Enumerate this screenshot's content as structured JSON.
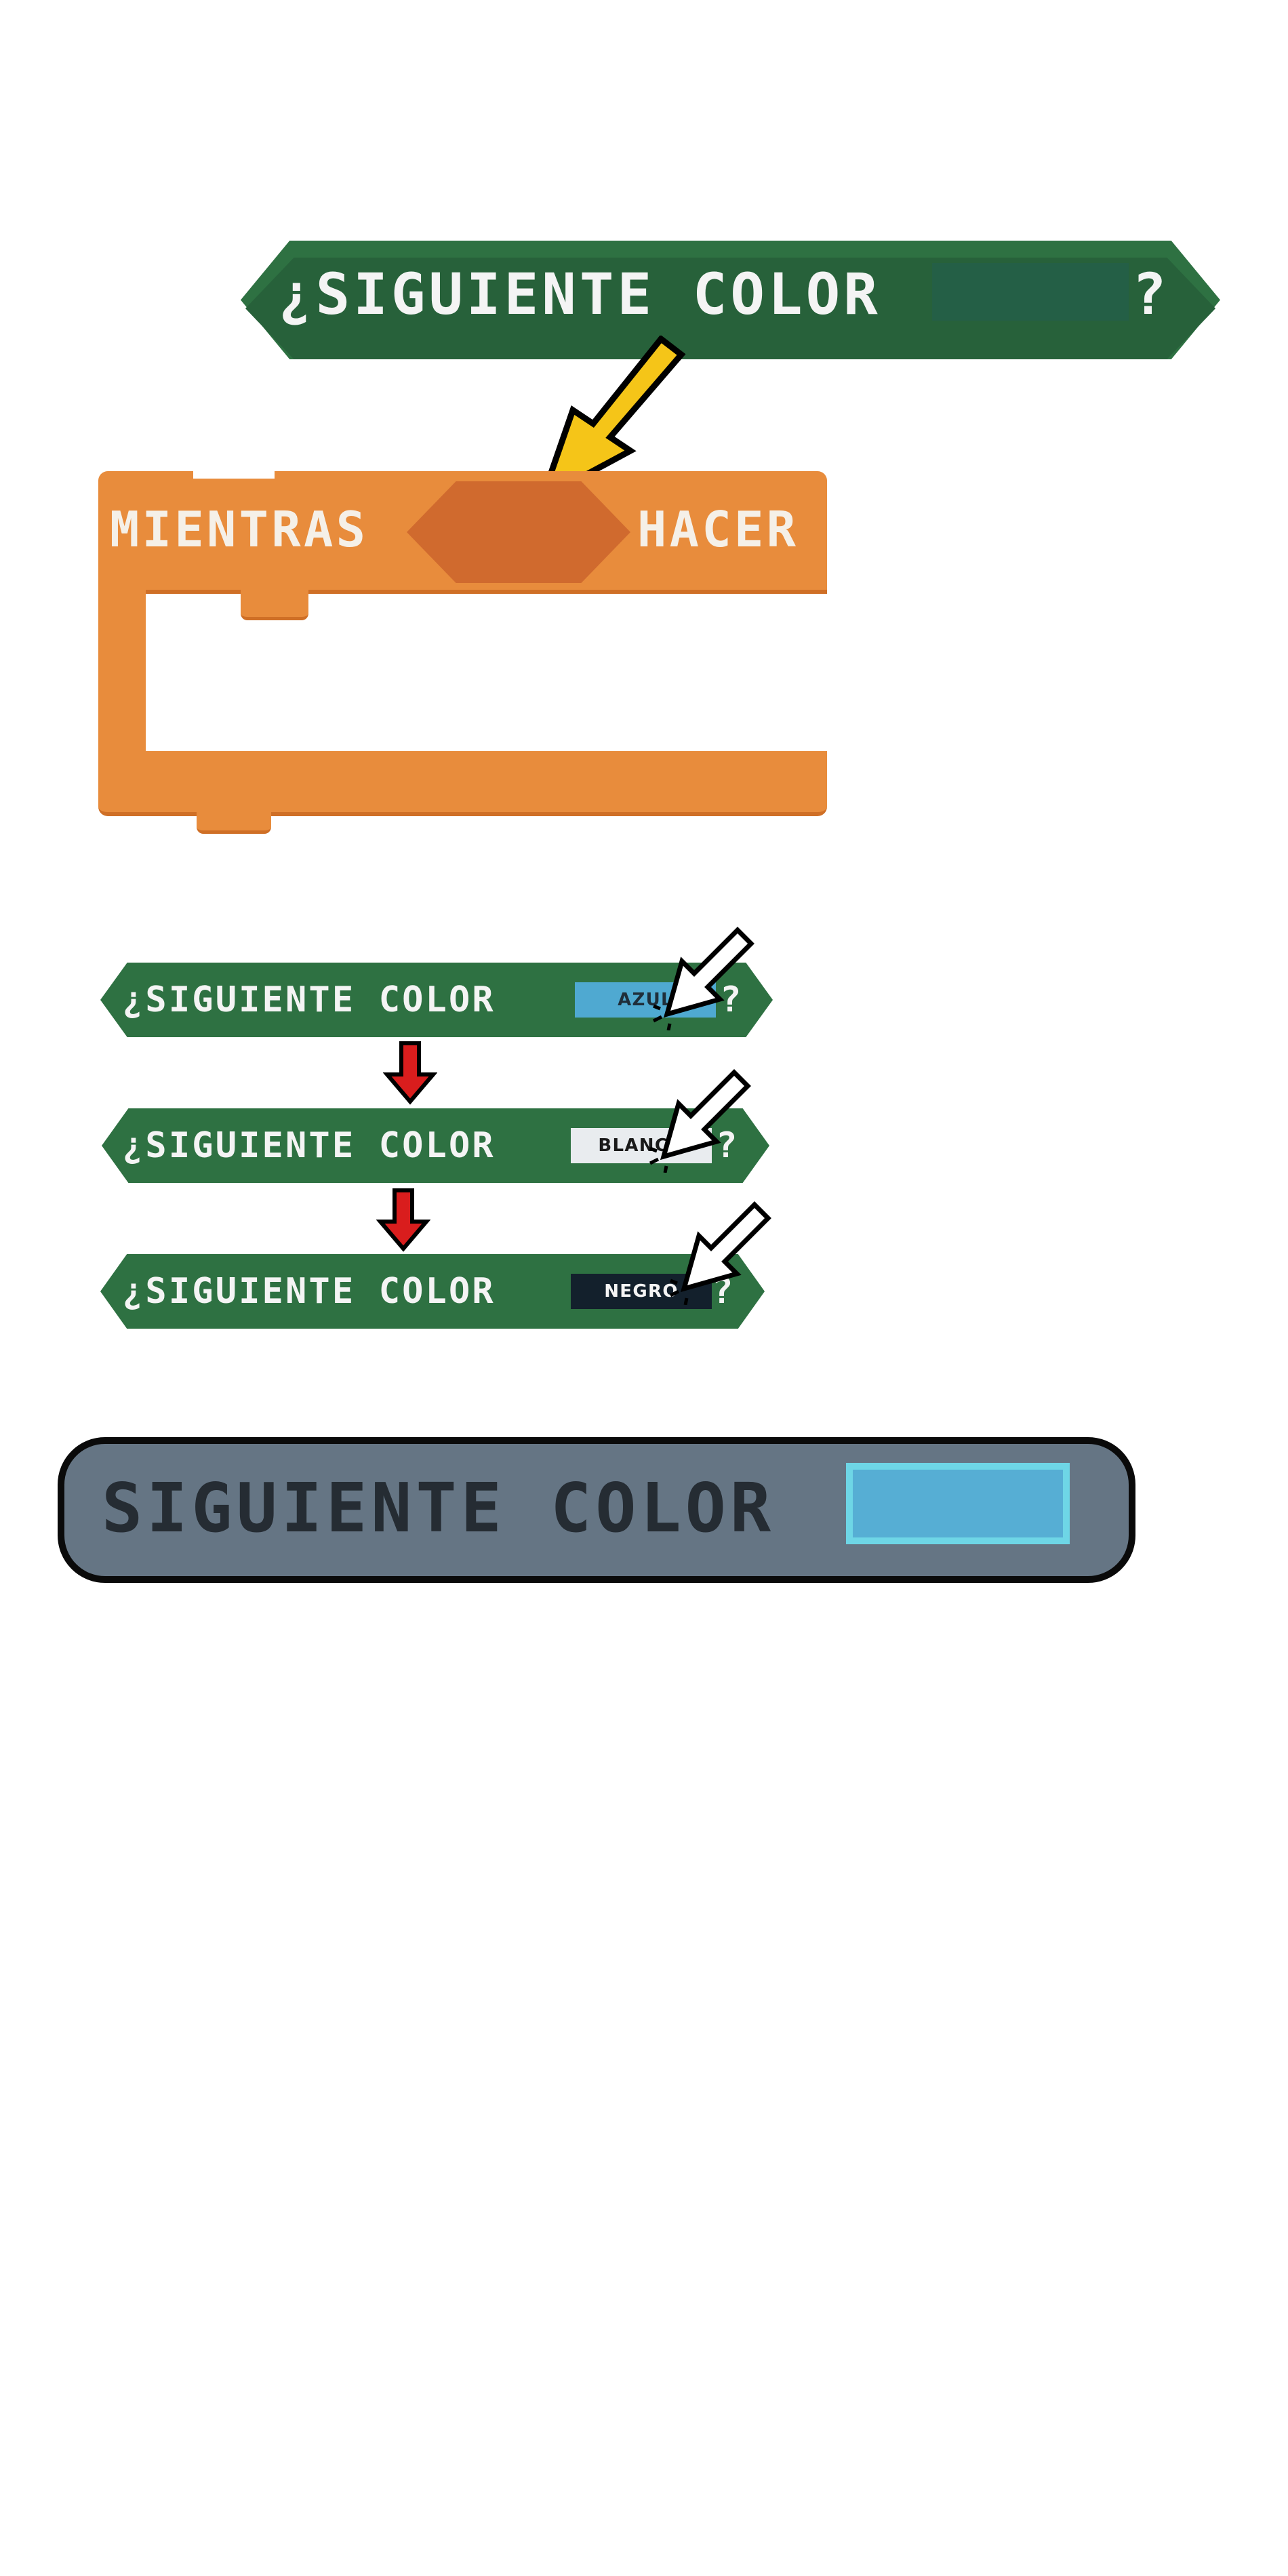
{
  "hero_block": {
    "label": "¿SIGUIENTE COLOR",
    "question_mark": "?",
    "colors": {
      "block": "#2e7142",
      "slot": "#245f46",
      "text": "#f4f4f4"
    }
  },
  "arrow_pointer": {
    "color": "#f5c518",
    "icon": "down-left-arrow-icon"
  },
  "while_loop": {
    "while_label": "MIENTRAS",
    "do_label": "HACER",
    "colors": {
      "block": "#e88c3c",
      "slot": "#d06a2e",
      "text": "#f5f0e8"
    }
  },
  "sequence": [
    {
      "label": "¿SIGUIENTE COLOR",
      "slot_value": "AZUL",
      "question_mark": "?",
      "slot_color": "#4fa9d1",
      "slot_text_color": "#1f2e3a"
    },
    {
      "label": "¿SIGUIENTE COLOR",
      "slot_value": "BLANCO",
      "question_mark": "?",
      "slot_color": "#e9ecef",
      "slot_text_color": "#1a1a1a"
    },
    {
      "label": "¿SIGUIENTE COLOR",
      "slot_value": "NEGRO",
      "question_mark": "?",
      "slot_color": "#13202c",
      "slot_text_color": "#f4f4f4"
    }
  ],
  "sequence_arrows": {
    "color": "#d91d1d",
    "icon": "down-arrow-icon"
  },
  "grey_block": {
    "label": "SIGUIENTE COLOR",
    "colors": {
      "block": "#657584",
      "text": "#252c33",
      "slot": "#56aed4",
      "slot_border": "#6ed6e6"
    }
  }
}
